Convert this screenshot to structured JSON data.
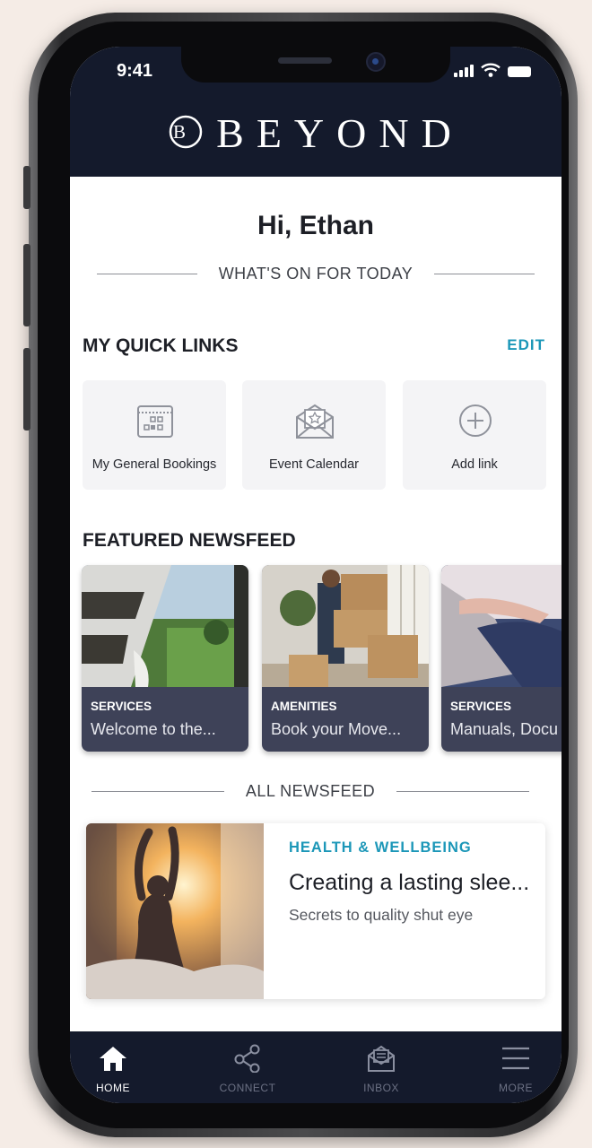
{
  "status_bar": {
    "time": "9:41"
  },
  "brand": {
    "logo_letter": "B",
    "name": "BEYOND"
  },
  "greeting": "Hi, Ethan",
  "today_divider": "WHAT'S ON FOR TODAY",
  "quick_links": {
    "title": "MY QUICK LINKS",
    "edit_label": "EDIT",
    "items": [
      {
        "label": "My General Bookings",
        "icon": "calendar-icon"
      },
      {
        "label": "Event Calendar",
        "icon": "invitation-envelope-icon"
      },
      {
        "label": "Add link",
        "icon": "add-circle-icon"
      }
    ]
  },
  "featured": {
    "title": "FEATURED NEWSFEED",
    "items": [
      {
        "category": "SERVICES",
        "title": "Welcome to the..."
      },
      {
        "category": "AMENITIES",
        "title": "Book your Move..."
      },
      {
        "category": "SERVICES",
        "title": "Manuals, Docu"
      }
    ]
  },
  "all_divider": "ALL NEWSFEED",
  "newsfeed": [
    {
      "category": "HEALTH & WELLBEING",
      "title": "Creating a lasting slee...",
      "subtitle": "Secrets to quality shut eye"
    }
  ],
  "tabbar": {
    "items": [
      {
        "label": "HOME",
        "icon": "home-icon",
        "active": true
      },
      {
        "label": "CONNECT",
        "icon": "share-nodes-icon",
        "active": false
      },
      {
        "label": "INBOX",
        "icon": "inbox-icon",
        "active": false
      },
      {
        "label": "MORE",
        "icon": "menu-icon",
        "active": false
      }
    ]
  },
  "colors": {
    "header_bg": "#141a2c",
    "accent": "#1c97b8",
    "card_overlay": "#3e4258",
    "background": "#f5ece6"
  }
}
